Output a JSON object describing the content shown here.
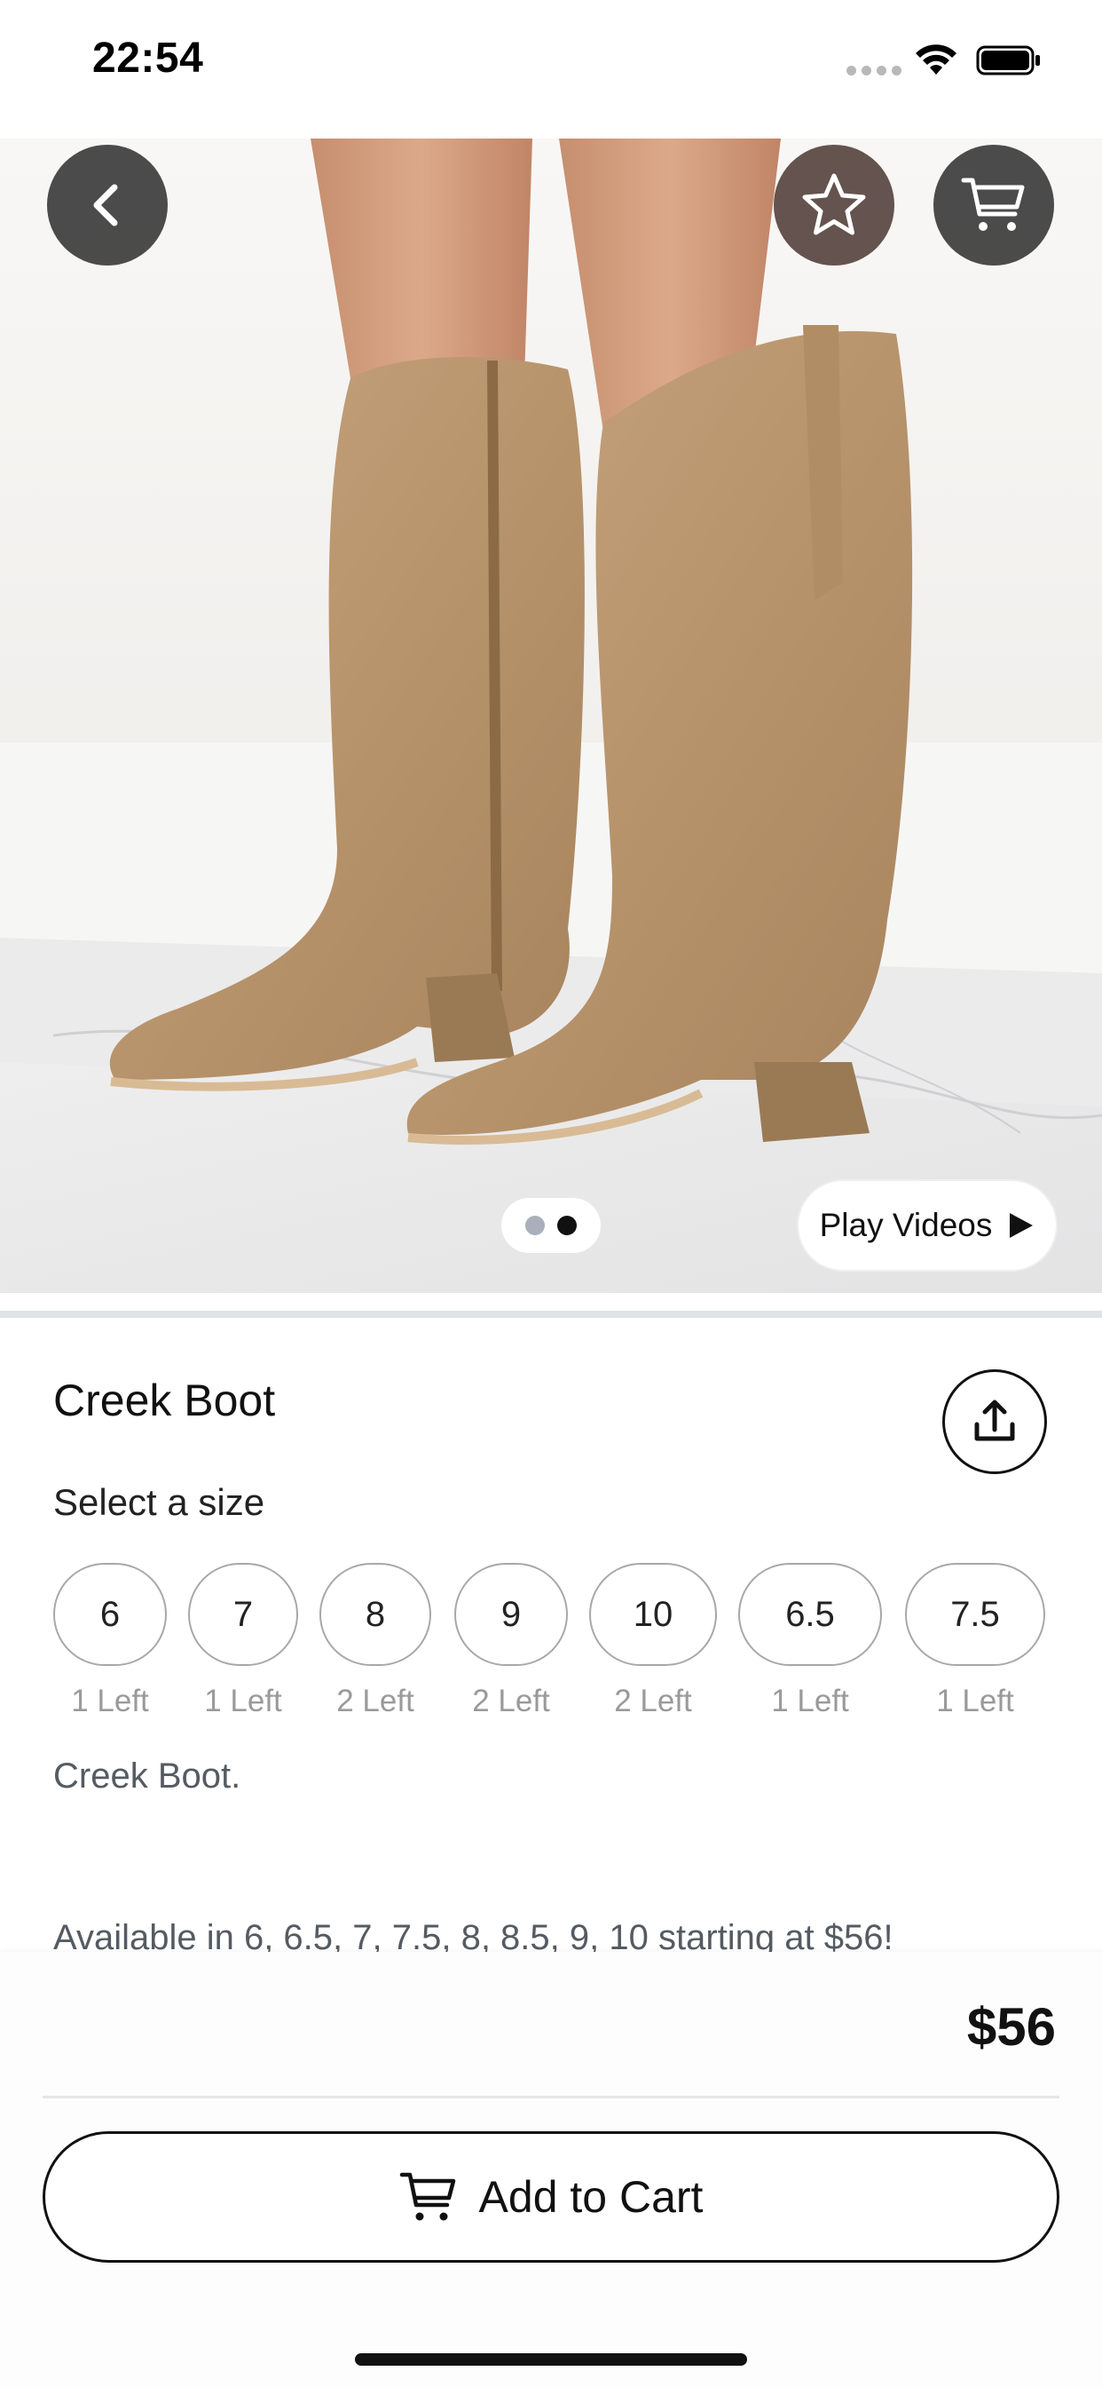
{
  "status_bar": {
    "time": "22:54"
  },
  "hero": {
    "play_videos_label": "Play Videos",
    "page_count": 2,
    "active_page": 2
  },
  "product": {
    "title": "Creek Boot",
    "size_prompt": "Select a size",
    "sizes": [
      {
        "size": "6",
        "stock": "1 Left"
      },
      {
        "size": "7",
        "stock": "1 Left"
      },
      {
        "size": "8",
        "stock": "2 Left"
      },
      {
        "size": "9",
        "stock": "2 Left"
      },
      {
        "size": "10",
        "stock": "2 Left"
      },
      {
        "size": "6.5",
        "stock": "1 Left"
      },
      {
        "size": "7.5",
        "stock": "1 Left"
      }
    ],
    "description_1": "Creek Boot.",
    "description_2": "Available in 6, 6.5, 7, 7.5, 8, 8.5, 9, 10 starting at $56!"
  },
  "checkout": {
    "price": "$56",
    "add_to_cart_label": "Add to Cart"
  },
  "icons": {
    "back": "chevron-left-icon",
    "favorite": "star-icon",
    "cart": "cart-icon",
    "share": "share-upload-icon",
    "play": "play-icon"
  }
}
